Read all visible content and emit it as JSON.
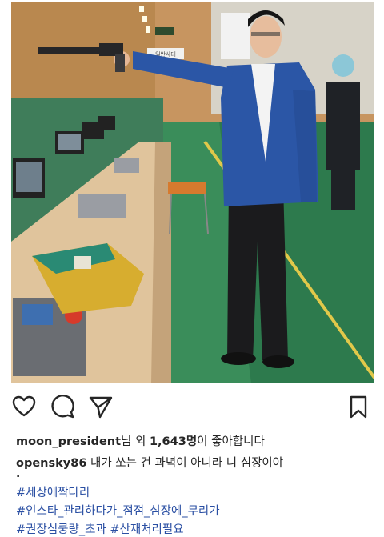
{
  "post": {
    "image_icon": "photo-shooting-range",
    "sign_text": "일반사대"
  },
  "actions": {
    "like_icon": "heart-icon",
    "comment_icon": "comment-icon",
    "share_icon": "send-icon",
    "save_icon": "bookmark-icon"
  },
  "likes": {
    "username": "moon_president",
    "text_after_name": "님 외 ",
    "count": "1,643명",
    "text_end": "이 좋아합니다"
  },
  "caption": {
    "username": "opensky86",
    "text": " 내가 쏘는 건 과녁이 아니라 니 심장이야",
    "separator": "."
  },
  "hashtags": [
    "#세상에짝다리",
    "#인스타_관리하다가_점점_심장에_무리가",
    "#권장심쿵량_초과 #산재처리필요"
  ],
  "colors": {
    "hashtag": "#2a4fa3",
    "text": "#262626"
  }
}
